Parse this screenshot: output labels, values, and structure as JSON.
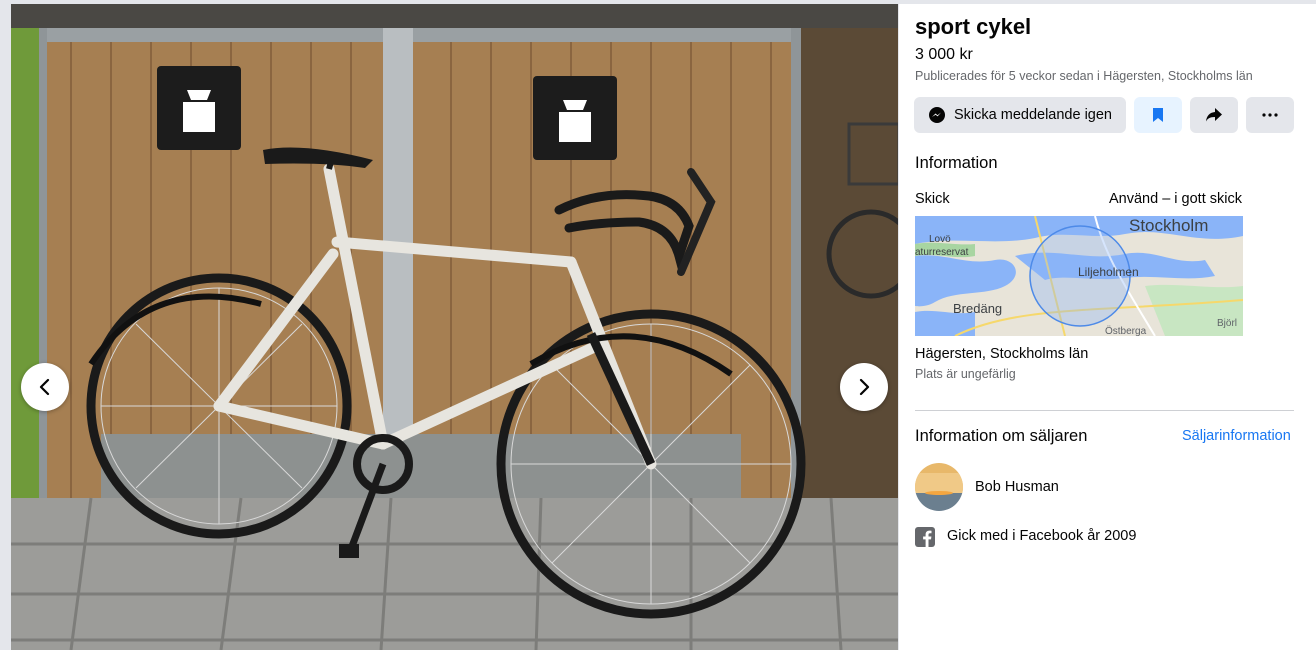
{
  "listing": {
    "title": "sport cykel",
    "price": "3 000 kr",
    "published": "Publicerades för 5 veckor sedan i Hägersten, Stockholms län"
  },
  "actions": {
    "message_label": "Skicka meddelande igen",
    "save_icon": "bookmark-icon",
    "share_icon": "share-icon",
    "more_icon": "more-icon"
  },
  "information": {
    "heading": "Information",
    "condition_label": "Skick",
    "condition_value": "Använd – i gott skick"
  },
  "map": {
    "labels": {
      "city": "Stockholm",
      "area": "Liljeholmen",
      "south_west": "Bredäng",
      "west": "Lovö",
      "west2": "aturreservat",
      "south": "Östberga",
      "east": "Björl"
    }
  },
  "location": {
    "name": "Hägersten, Stockholms län",
    "note": "Plats är ungefärlig"
  },
  "seller": {
    "heading": "Information om säljaren",
    "details_link": "Säljarinformation",
    "name": "Bob Husman",
    "joined": "Gick med i Facebook år 2009"
  },
  "colors": {
    "accent": "#1877f2",
    "button_bg": "#e4e6eb",
    "save_bg": "#e7f3ff",
    "secondary_text": "#65676b"
  }
}
